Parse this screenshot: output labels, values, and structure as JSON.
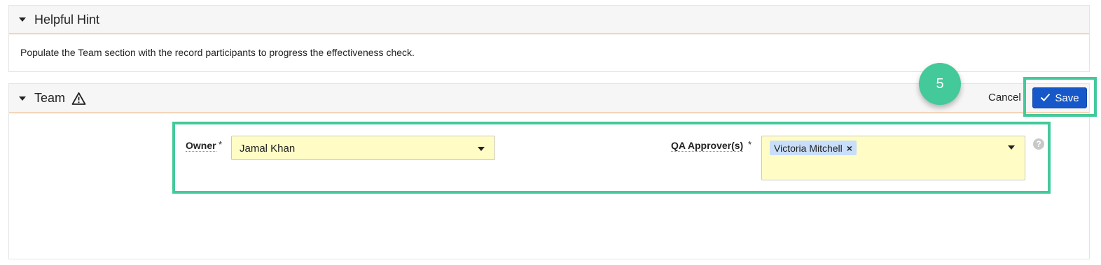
{
  "hint": {
    "title": "Helpful Hint",
    "text": "Populate the Team section with the record participants to progress the effectiveness check."
  },
  "team": {
    "title": "Team",
    "cancel_label": "Cancel",
    "save_label": "Save",
    "owner": {
      "label": "Owner",
      "required_mark": "*",
      "value": "Jamal Khan"
    },
    "qa_approvers": {
      "label": "QA Approver(s)",
      "required_mark": "*",
      "chips": [
        "Victoria Mitchell"
      ],
      "chip_remove_symbol": "×"
    },
    "help_symbol": "?"
  },
  "annotation": {
    "step_number": "5",
    "highlight_color": "#43c99a"
  },
  "colors": {
    "accent_blue": "#1658c9",
    "field_background": "#fffcc6",
    "header_underline": "#f0a05a",
    "chip_background": "#c9def8"
  },
  "icons": [
    "caret-down-icon",
    "warning-icon",
    "check-icon",
    "chip-remove-icon",
    "help-icon"
  ]
}
